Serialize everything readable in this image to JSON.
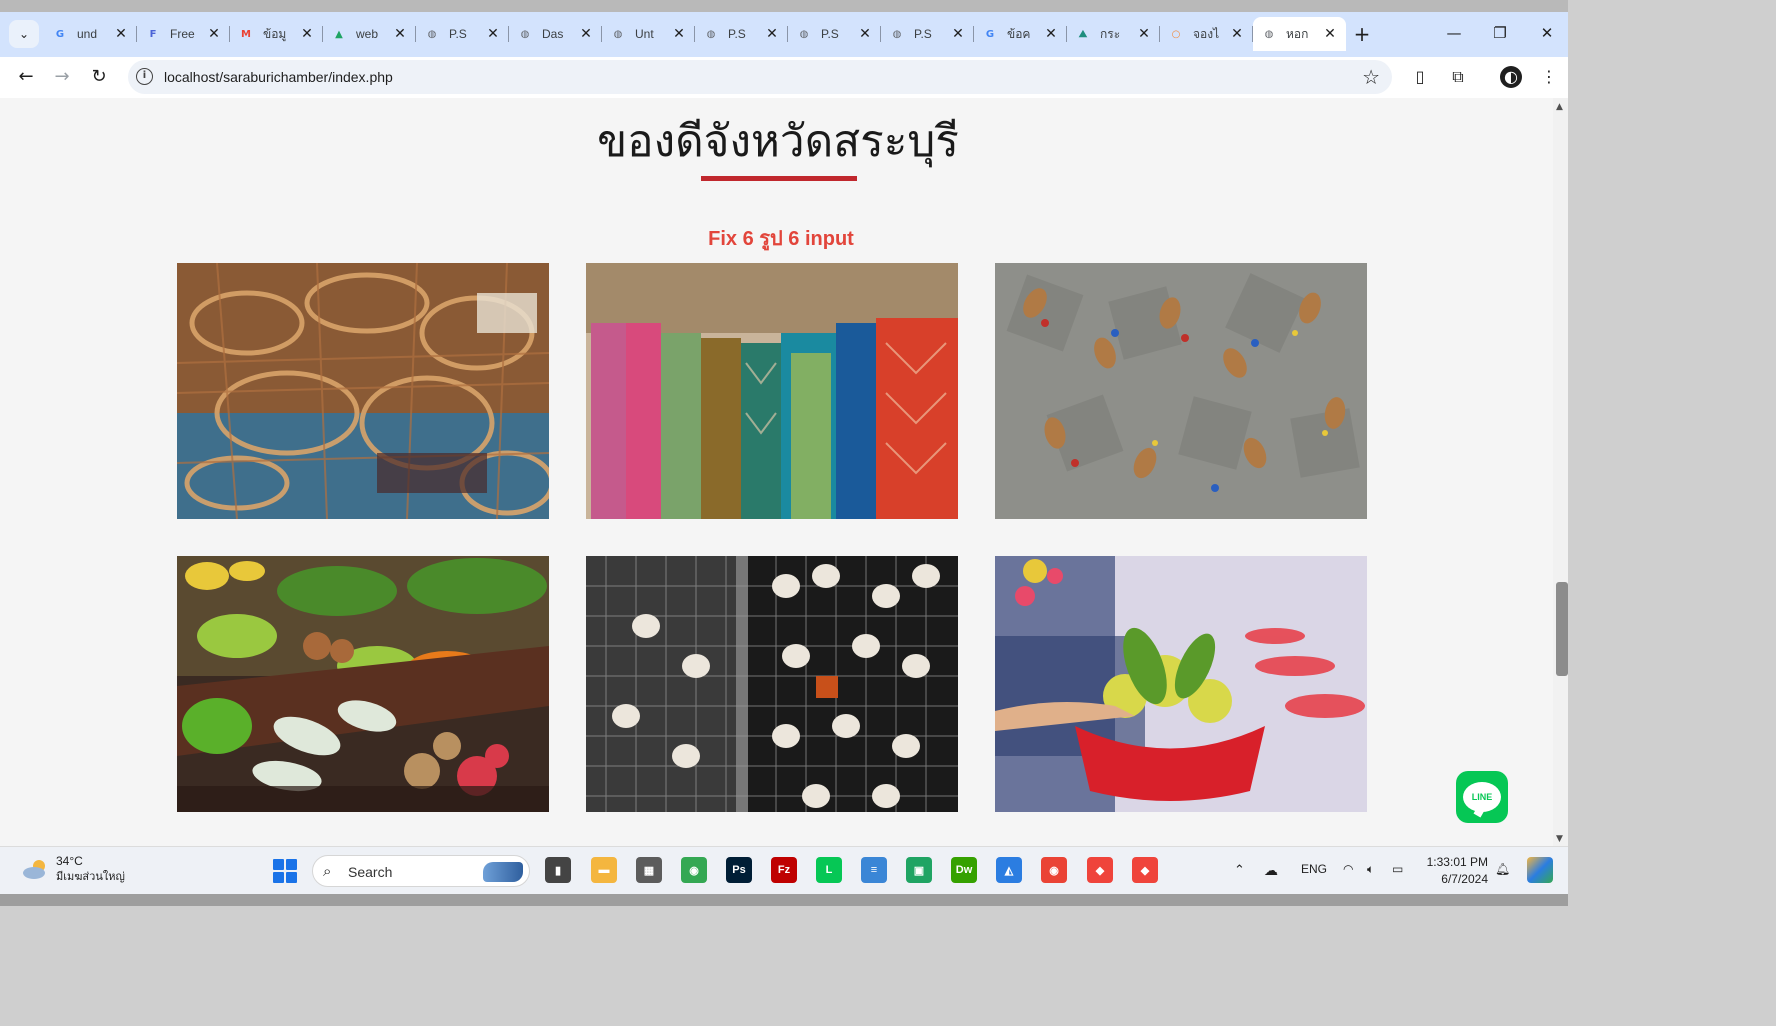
{
  "browser": {
    "tabs": [
      {
        "title": "und",
        "icon": "google-icon",
        "color": "#4285f4",
        "glyph": "G"
      },
      {
        "title": "Free",
        "icon": "forms-icon",
        "color": "#4a63d6",
        "glyph": "F"
      },
      {
        "title": "ข้อมู",
        "icon": "gmail-icon",
        "color": "#ea4335",
        "glyph": "M"
      },
      {
        "title": "web",
        "icon": "drive-icon",
        "color": "#1fa463",
        "glyph": "▲"
      },
      {
        "title": "P.S",
        "icon": "globe-icon",
        "color": "#5f6368",
        "glyph": "◍"
      },
      {
        "title": "Das",
        "icon": "globe-icon",
        "color": "#5f6368",
        "glyph": "◍"
      },
      {
        "title": "Unt",
        "icon": "globe-icon",
        "color": "#5f6368",
        "glyph": "◍"
      },
      {
        "title": "P.S",
        "icon": "globe-icon",
        "color": "#5f6368",
        "glyph": "◍"
      },
      {
        "title": "P.S",
        "icon": "globe-icon",
        "color": "#5f6368",
        "glyph": "◍"
      },
      {
        "title": "P.S",
        "icon": "globe-icon",
        "color": "#5f6368",
        "glyph": "◍"
      },
      {
        "title": "ข้อค",
        "icon": "google-icon",
        "color": "#4285f4",
        "glyph": "G"
      },
      {
        "title": "กระ",
        "icon": "mountain-icon",
        "color": "#1e8e7e",
        "glyph": "⛰"
      },
      {
        "title": "จองไ",
        "icon": "ring-icon",
        "color": "#f28b3c",
        "glyph": "○"
      },
      {
        "title": "หอก",
        "icon": "globe-icon",
        "color": "#5f6368",
        "glyph": "◍",
        "active": true
      }
    ],
    "new_tab": "+",
    "url": "localhost/saraburichamber/index.php"
  },
  "page": {
    "heading": "ของดีจังหวัดสระบุรี",
    "subtitle": "Fix 6 รูป 6 input",
    "photos": [
      {
        "name": "photo-wicker-baskets",
        "subject": "wicker baskets"
      },
      {
        "name": "photo-woven-bags",
        "subject": "woven bags"
      },
      {
        "name": "photo-wooden-spoons",
        "subject": "wooden spoons"
      },
      {
        "name": "photo-market-boat-produce",
        "subject": "market boat produce"
      },
      {
        "name": "photo-hanging-cups",
        "subject": "hanging cups"
      },
      {
        "name": "photo-flower-offerings",
        "subject": "flower offerings"
      }
    ],
    "line_button": "LINE",
    "accent_color": "#c0272d",
    "subtitle_color": "#e2453b"
  },
  "taskbar": {
    "weather_temp": "34°C",
    "weather_cond": "มีเมฆส่วนใหญ่",
    "search_label": "Search",
    "tray_lang": "ENG",
    "time": "1:33:01 PM",
    "date": "6/7/2024",
    "apps": [
      {
        "name": "taskview-app",
        "glyph": "▮",
        "bg": "#444444"
      },
      {
        "name": "file-explorer-app",
        "glyph": "▬",
        "bg": "#f4b63f"
      },
      {
        "name": "calculator-app",
        "glyph": "▦",
        "bg": "#5c5c5c"
      },
      {
        "name": "chrome-app",
        "glyph": "◉",
        "bg": "#34a853"
      },
      {
        "name": "photoshop-app",
        "glyph": "Ps",
        "bg": "#001e36"
      },
      {
        "name": "filezilla-app",
        "glyph": "Fz",
        "bg": "#bf0000"
      },
      {
        "name": "line-app",
        "glyph": "L",
        "bg": "#06c755"
      },
      {
        "name": "notepad-app",
        "glyph": "≡",
        "bg": "#3a86d6"
      },
      {
        "name": "green-app",
        "glyph": "▣",
        "bg": "#1fa463"
      },
      {
        "name": "dreamweaver-app",
        "glyph": "Dw",
        "bg": "#35a100"
      },
      {
        "name": "photos-app",
        "glyph": "◭",
        "bg": "#2b7de1"
      },
      {
        "name": "chrome-profile-app",
        "glyph": "◉",
        "bg": "#ea4335"
      },
      {
        "name": "anydesk-app",
        "glyph": "◆",
        "bg": "#ef443b"
      },
      {
        "name": "anydesk-app-2",
        "glyph": "◆",
        "bg": "#ef443b"
      }
    ]
  }
}
